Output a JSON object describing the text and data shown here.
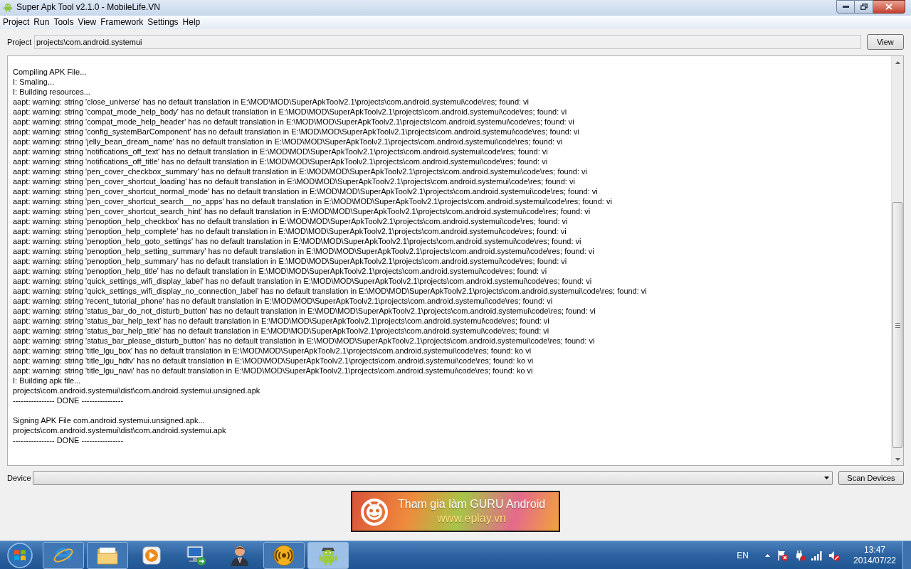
{
  "window": {
    "title": "Super Apk Tool v2.1.0 - MobileLife.VN"
  },
  "menu": [
    "Project",
    "Run",
    "Tools",
    "View",
    "Framework",
    "Settings",
    "Help"
  ],
  "project": {
    "label": "Project",
    "value": "projects\\com.android.systemui",
    "button": "View"
  },
  "log": {
    "sections": [
      [
        "Compiling APK File...",
        "I: Smaling...",
        "I: Building resources...",
        "aapt: warning: string 'close_universe' has no default translation in E:\\MOD\\MOD\\SuperApkToolv2.1\\projects\\com.android.systemui\\code\\res; found: vi",
        "aapt: warning: string 'compat_mode_help_body' has no default translation in E:\\MOD\\MOD\\SuperApkToolv2.1\\projects\\com.android.systemui\\code\\res; found: vi",
        "aapt: warning: string 'compat_mode_help_header' has no default translation in E:\\MOD\\MOD\\SuperApkToolv2.1\\projects\\com.android.systemui\\code\\res; found: vi",
        "aapt: warning: string 'config_systemBarComponent' has no default translation in E:\\MOD\\MOD\\SuperApkToolv2.1\\projects\\com.android.systemui\\code\\res; found: vi",
        "aapt: warning: string 'jelly_bean_dream_name' has no default translation in E:\\MOD\\MOD\\SuperApkToolv2.1\\projects\\com.android.systemui\\code\\res; found: vi",
        "aapt: warning: string 'notifications_off_text' has no default translation in E:\\MOD\\MOD\\SuperApkToolv2.1\\projects\\com.android.systemui\\code\\res; found: vi",
        "aapt: warning: string 'notifications_off_title' has no default translation in E:\\MOD\\MOD\\SuperApkToolv2.1\\projects\\com.android.systemui\\code\\res; found: vi",
        "aapt: warning: string 'pen_cover_checkbox_summary' has no default translation in E:\\MOD\\MOD\\SuperApkToolv2.1\\projects\\com.android.systemui\\code\\res; found: vi",
        "aapt: warning: string 'pen_cover_shortcut_loading' has no default translation in E:\\MOD\\MOD\\SuperApkToolv2.1\\projects\\com.android.systemui\\code\\res; found: vi",
        "aapt: warning: string 'pen_cover_shortcut_normal_mode' has no default translation in E:\\MOD\\MOD\\SuperApkToolv2.1\\projects\\com.android.systemui\\code\\res; found: vi",
        "aapt: warning: string 'pen_cover_shortcut_search__no_apps' has no default translation in E:\\MOD\\MOD\\SuperApkToolv2.1\\projects\\com.android.systemui\\code\\res; found: vi",
        "aapt: warning: string 'pen_cover_shortcut_search_hint' has no default translation in E:\\MOD\\MOD\\SuperApkToolv2.1\\projects\\com.android.systemui\\code\\res; found: vi",
        "aapt: warning: string 'penoption_help_checkbox' has no default translation in E:\\MOD\\MOD\\SuperApkToolv2.1\\projects\\com.android.systemui\\code\\res; found: vi",
        "aapt: warning: string 'penoption_help_complete' has no default translation in E:\\MOD\\MOD\\SuperApkToolv2.1\\projects\\com.android.systemui\\code\\res; found: vi",
        "aapt: warning: string 'penoption_help_goto_settings' has no default translation in E:\\MOD\\MOD\\SuperApkToolv2.1\\projects\\com.android.systemui\\code\\res; found: vi",
        "aapt: warning: string 'penoption_help_setting_summary' has no default translation in E:\\MOD\\MOD\\SuperApkToolv2.1\\projects\\com.android.systemui\\code\\res; found: vi",
        "aapt: warning: string 'penoption_help_summary' has no default translation in E:\\MOD\\MOD\\SuperApkToolv2.1\\projects\\com.android.systemui\\code\\res; found: vi",
        "aapt: warning: string 'penoption_help_title' has no default translation in E:\\MOD\\MOD\\SuperApkToolv2.1\\projects\\com.android.systemui\\code\\res; found: vi",
        "aapt: warning: string 'quick_settings_wifi_display_label' has no default translation in E:\\MOD\\MOD\\SuperApkToolv2.1\\projects\\com.android.systemui\\code\\res; found: vi",
        "aapt: warning: string 'quick_settings_wifi_display_no_connection_label' has no default translation in E:\\MOD\\MOD\\SuperApkToolv2.1\\projects\\com.android.systemui\\code\\res; found: vi",
        "aapt: warning: string 'recent_tutorial_phone' has no default translation in E:\\MOD\\MOD\\SuperApkToolv2.1\\projects\\com.android.systemui\\code\\res; found: vi",
        "aapt: warning: string 'status_bar_do_not_disturb_button' has no default translation in E:\\MOD\\MOD\\SuperApkToolv2.1\\projects\\com.android.systemui\\code\\res; found: vi",
        "aapt: warning: string 'status_bar_help_text' has no default translation in E:\\MOD\\MOD\\SuperApkToolv2.1\\projects\\com.android.systemui\\code\\res; found: vi",
        "aapt: warning: string 'status_bar_help_title' has no default translation in E:\\MOD\\MOD\\SuperApkToolv2.1\\projects\\com.android.systemui\\code\\res; found: vi",
        "aapt: warning: string 'status_bar_please_disturb_button' has no default translation in E:\\MOD\\MOD\\SuperApkToolv2.1\\projects\\com.android.systemui\\code\\res; found: vi",
        "aapt: warning: string 'title_lgu_box' has no default translation in E:\\MOD\\MOD\\SuperApkToolv2.1\\projects\\com.android.systemui\\code\\res; found: ko vi",
        "aapt: warning: string 'title_lgu_hdtv' has no default translation in E:\\MOD\\MOD\\SuperApkToolv2.1\\projects\\com.android.systemui\\code\\res; found: ko vi",
        "aapt: warning: string 'title_lgu_navi' has no default translation in E:\\MOD\\MOD\\SuperApkToolv2.1\\projects\\com.android.systemui\\code\\res; found: ko vi",
        "I: Building apk file...",
        "projects\\com.android.systemui\\dist\\com.android.systemui.unsigned.apk",
        "---------------- DONE ----------------"
      ],
      [
        "Signing APK File com.android.systemui.unsigned.apk...",
        "projects\\com.android.systemui\\dist\\com.android.systemui.apk",
        "---------------- DONE ----------------"
      ]
    ]
  },
  "device": {
    "label": "Device",
    "button": "Scan Devices"
  },
  "banner": {
    "headline": "Tham gia làm GURU Android",
    "url": "www.eplay.vn"
  },
  "taskbar": {
    "apps": [
      {
        "running": true,
        "selected": false
      },
      {
        "running": true,
        "selected": false
      },
      {
        "running": false,
        "selected": false
      },
      {
        "running": false,
        "selected": false
      },
      {
        "running": false,
        "selected": false
      },
      {
        "running": true,
        "selected": false
      },
      {
        "running": true,
        "selected": true
      }
    ],
    "language": "EN",
    "time": "13:47",
    "date": "2014/07/22"
  }
}
